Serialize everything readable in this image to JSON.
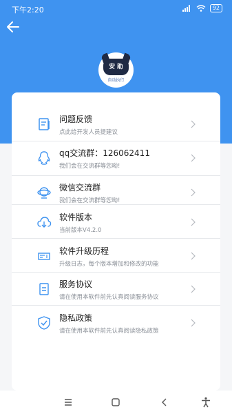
{
  "status": {
    "time": "下午2:20",
    "battery": "92"
  },
  "logo": {
    "face_text": "安 助",
    "caption": "自动执行"
  },
  "items": [
    {
      "title": "问题反馈",
      "subtitle": "点此给开发人员提建议",
      "icon": "feedback-icon"
    },
    {
      "title": "qq交流群：126062411",
      "subtitle": "我们会在交流群等您呦!",
      "icon": "qq-icon"
    },
    {
      "title": "微信交流群",
      "subtitle": "我们会在交流群等您呦!",
      "icon": "wechat-group-icon"
    },
    {
      "title": "软件版本",
      "subtitle": "当前版本V4.2.0",
      "icon": "download-cloud-icon"
    },
    {
      "title": "软件升级历程",
      "subtitle": "升级日志，每个版本增加和修改的功能",
      "icon": "upgrade-history-icon"
    },
    {
      "title": "服务协议",
      "subtitle": "请在使用本软件前先认真阅读服务协议",
      "icon": "document-icon"
    },
    {
      "title": "隐私政策",
      "subtitle": "请在使用本软件前先认真阅读隐私政策",
      "icon": "shield-check-icon"
    }
  ],
  "colors": {
    "primary": "#3f93f0",
    "icon": "#3f93f0"
  }
}
